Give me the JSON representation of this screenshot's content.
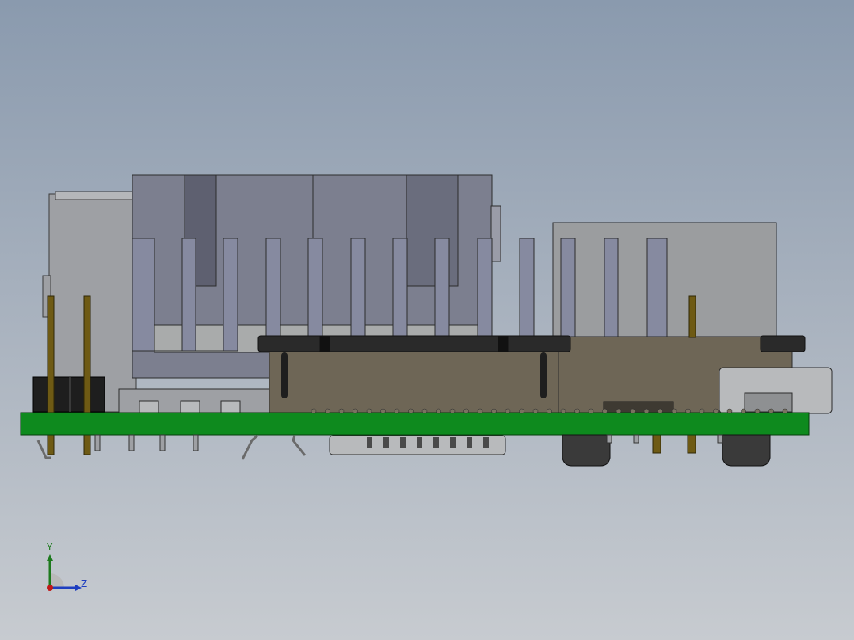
{
  "viewport": {
    "background_top": "#8a9aae",
    "background_bottom": "#c7cbd0",
    "content": "pcb-assembly-side-view"
  },
  "colors": {
    "pcb_green": "#0e8a1e",
    "connector_gray": "#7d8090",
    "housing_olive": "#6e6656",
    "pin_brass": "#6e5a14",
    "black_header": "#2a2a2a"
  },
  "triad": {
    "y_label": "Y",
    "z_label": "Z",
    "y_color": "#1d7a1d",
    "z_color": "#1e3ec0",
    "x_color": "#c01818"
  }
}
